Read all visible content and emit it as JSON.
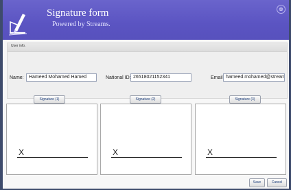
{
  "header": {
    "title": "Signature form",
    "subtitle": "Powered by Streams.",
    "close_glyph": "⊗"
  },
  "user_info": {
    "panel_title": "User info.",
    "name_label": "Name:",
    "name_value": "Hameed Mohamed Hamed",
    "national_id_label": "National ID:",
    "national_id_value": "26518021152341",
    "email_label": "Email:",
    "email_value": "hameed.mohamed@streams.co"
  },
  "signatures": [
    {
      "button_label": "Signature (1)",
      "mark": "X"
    },
    {
      "button_label": "Signature (2)",
      "mark": "X"
    },
    {
      "button_label": "Signature (3)",
      "mark": "X"
    }
  ],
  "actions": {
    "save_label": "Save",
    "cancel_label": "Cancel"
  },
  "icons": {
    "logo": "signature-pen-icon",
    "close": "close-circle-icon"
  },
  "colors": {
    "header": "#5b54c2",
    "window_frame": "#3e4b6c",
    "button_text": "#1b3d7a"
  }
}
